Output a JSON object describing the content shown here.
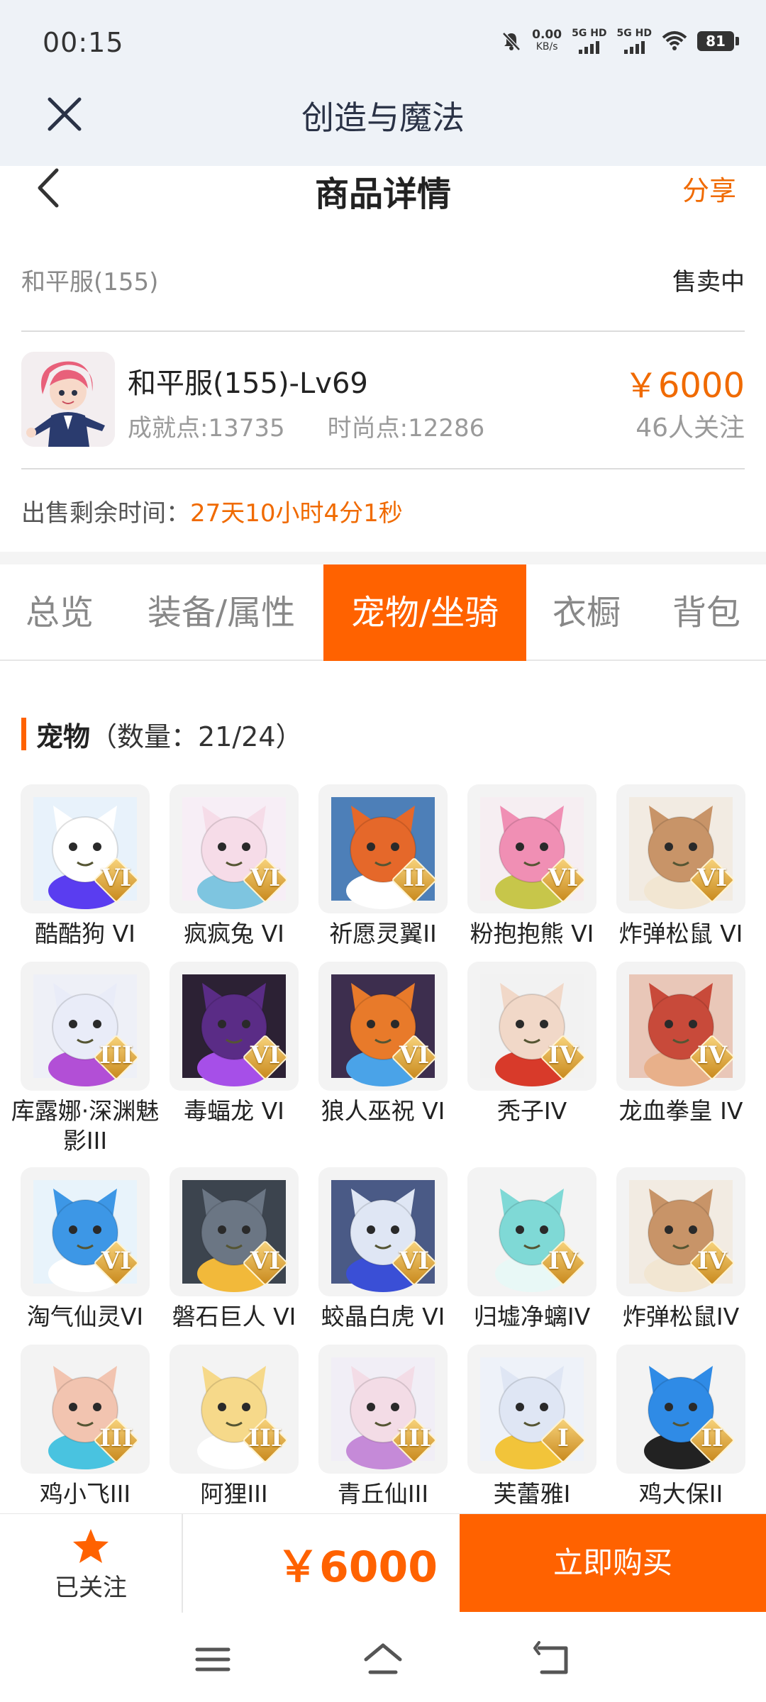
{
  "status": {
    "time": "00:15",
    "net_speed": "0.00",
    "net_unit": "KB/s",
    "sim1": "5G HD",
    "sim2": "5G HD",
    "battery": "81"
  },
  "app": {
    "title": "创造与魔法"
  },
  "header": {
    "title": "商品详情",
    "share": "分享"
  },
  "listing": {
    "server": "和平服(155)",
    "status": "售卖中",
    "character_name": "和平服(155)-Lv69",
    "achievement": "成就点:13735",
    "fashion": "时尚点:12286",
    "price": "￥6000",
    "followers": "46人关注",
    "remaining_label": "出售剩余时间：",
    "remaining_value": "27天10小时4分1秒"
  },
  "tabs": [
    "总览",
    "装备/属性",
    "宠物/坐骑",
    "衣橱",
    "背包"
  ],
  "active_tab": "宠物/坐骑",
  "pets_section": {
    "title": "宠物",
    "count": "（数量：21/24）"
  },
  "pets": [
    {
      "name": "酷酷狗 VI",
      "grade": "VI",
      "icon": "white-bear-goggles",
      "bg": "#e8f2fb",
      "main": "#ffffff",
      "accent": "#5a3df0"
    },
    {
      "name": "疯疯兔 VI",
      "grade": "VI",
      "icon": "pink-rabbit",
      "bg": "#f7eef6",
      "main": "#f6dce8",
      "accent": "#7ec5e0"
    },
    {
      "name": "祈愿灵翼II",
      "grade": "II",
      "icon": "griffin",
      "bg": "#4d7fb8",
      "main": "#e5682a",
      "accent": "#ffffff"
    },
    {
      "name": "粉抱抱熊 VI",
      "grade": "VI",
      "icon": "pink-bear",
      "bg": "#f6eef2",
      "main": "#f08fb4",
      "accent": "#c7c64a"
    },
    {
      "name": "炸弹松鼠 VI",
      "grade": "VI",
      "icon": "bomb-squirrel",
      "bg": "#f2ebe2",
      "main": "#c89468",
      "accent": "#f2e6d2"
    },
    {
      "name": "库露娜·深渊魅影III",
      "grade": "III",
      "icon": "white-spirit",
      "bg": "#eef0f7",
      "main": "#e9ecf8",
      "accent": "#b24fd6"
    },
    {
      "name": "毒蝠龙 VI",
      "grade": "VI",
      "icon": "purple-dragon",
      "bg": "#2c2134",
      "main": "#5a2c86",
      "accent": "#a64fe8"
    },
    {
      "name": "狼人巫祝 VI",
      "grade": "VI",
      "icon": "wolf-shaman",
      "bg": "#3d2e4e",
      "main": "#e87a2a",
      "accent": "#4aa3e8"
    },
    {
      "name": "秃子IV",
      "grade": "IV",
      "icon": "bald-guy",
      "bg": "#f2f2f2",
      "main": "#f1d8c8",
      "accent": "#d83a2a"
    },
    {
      "name": "龙血拳皇 IV",
      "grade": "IV",
      "icon": "red-dragon",
      "bg": "#e9c7b8",
      "main": "#c84a3a",
      "accent": "#e8b08a"
    },
    {
      "name": "淘气仙灵VI",
      "grade": "VI",
      "icon": "blue-dog",
      "bg": "#e8f3fb",
      "main": "#3d97e6",
      "accent": "#ffffff"
    },
    {
      "name": "磐石巨人 VI",
      "grade": "VI",
      "icon": "rock-giant",
      "bg": "#3c444e",
      "main": "#6b7684",
      "accent": "#f2b93a"
    },
    {
      "name": "蛟晶白虎 VI",
      "grade": "VI",
      "icon": "white-tiger",
      "bg": "#4a5a86",
      "main": "#dfe6f4",
      "accent": "#3a4fd6"
    },
    {
      "name": "归墟净螭IV",
      "grade": "IV",
      "icon": "teal-dragon",
      "bg": "#f3f3f3",
      "main": "#7fd9d6",
      "accent": "#e8f8f6"
    },
    {
      "name": "炸弹松鼠IV",
      "grade": "IV",
      "icon": "bomb-squirrel",
      "bg": "#f2ebe2",
      "main": "#c89468",
      "accent": "#f2e6d2"
    },
    {
      "name": "鸡小飞III",
      "grade": "III",
      "icon": "muscle-chick",
      "bg": "#f3f3f3",
      "main": "#f2c4b0",
      "accent": "#49c3e0"
    },
    {
      "name": "阿狸III",
      "grade": "III",
      "icon": "ali-fox",
      "bg": "#f3f3f3",
      "main": "#f6d98a",
      "accent": "#ffffff"
    },
    {
      "name": "青丘仙III",
      "grade": "III",
      "icon": "fox-fairy",
      "bg": "#f1eef6",
      "main": "#f3dce6",
      "accent": "#c58ad8"
    },
    {
      "name": "芙蕾雅I",
      "grade": "I",
      "icon": "goddess",
      "bg": "#eef2f9",
      "main": "#dfe6f4",
      "accent": "#f2c43a"
    },
    {
      "name": "鸡大保II",
      "grade": "II",
      "icon": "blue-chicken",
      "bg": "#f3f3f3",
      "main": "#2f8be6",
      "accent": "#222222"
    }
  ],
  "bottom": {
    "follow": "已关注",
    "price": "￥6000",
    "buy": "立即购买"
  },
  "colors": {
    "accent": "#ff6200",
    "price": "#f06a00"
  }
}
